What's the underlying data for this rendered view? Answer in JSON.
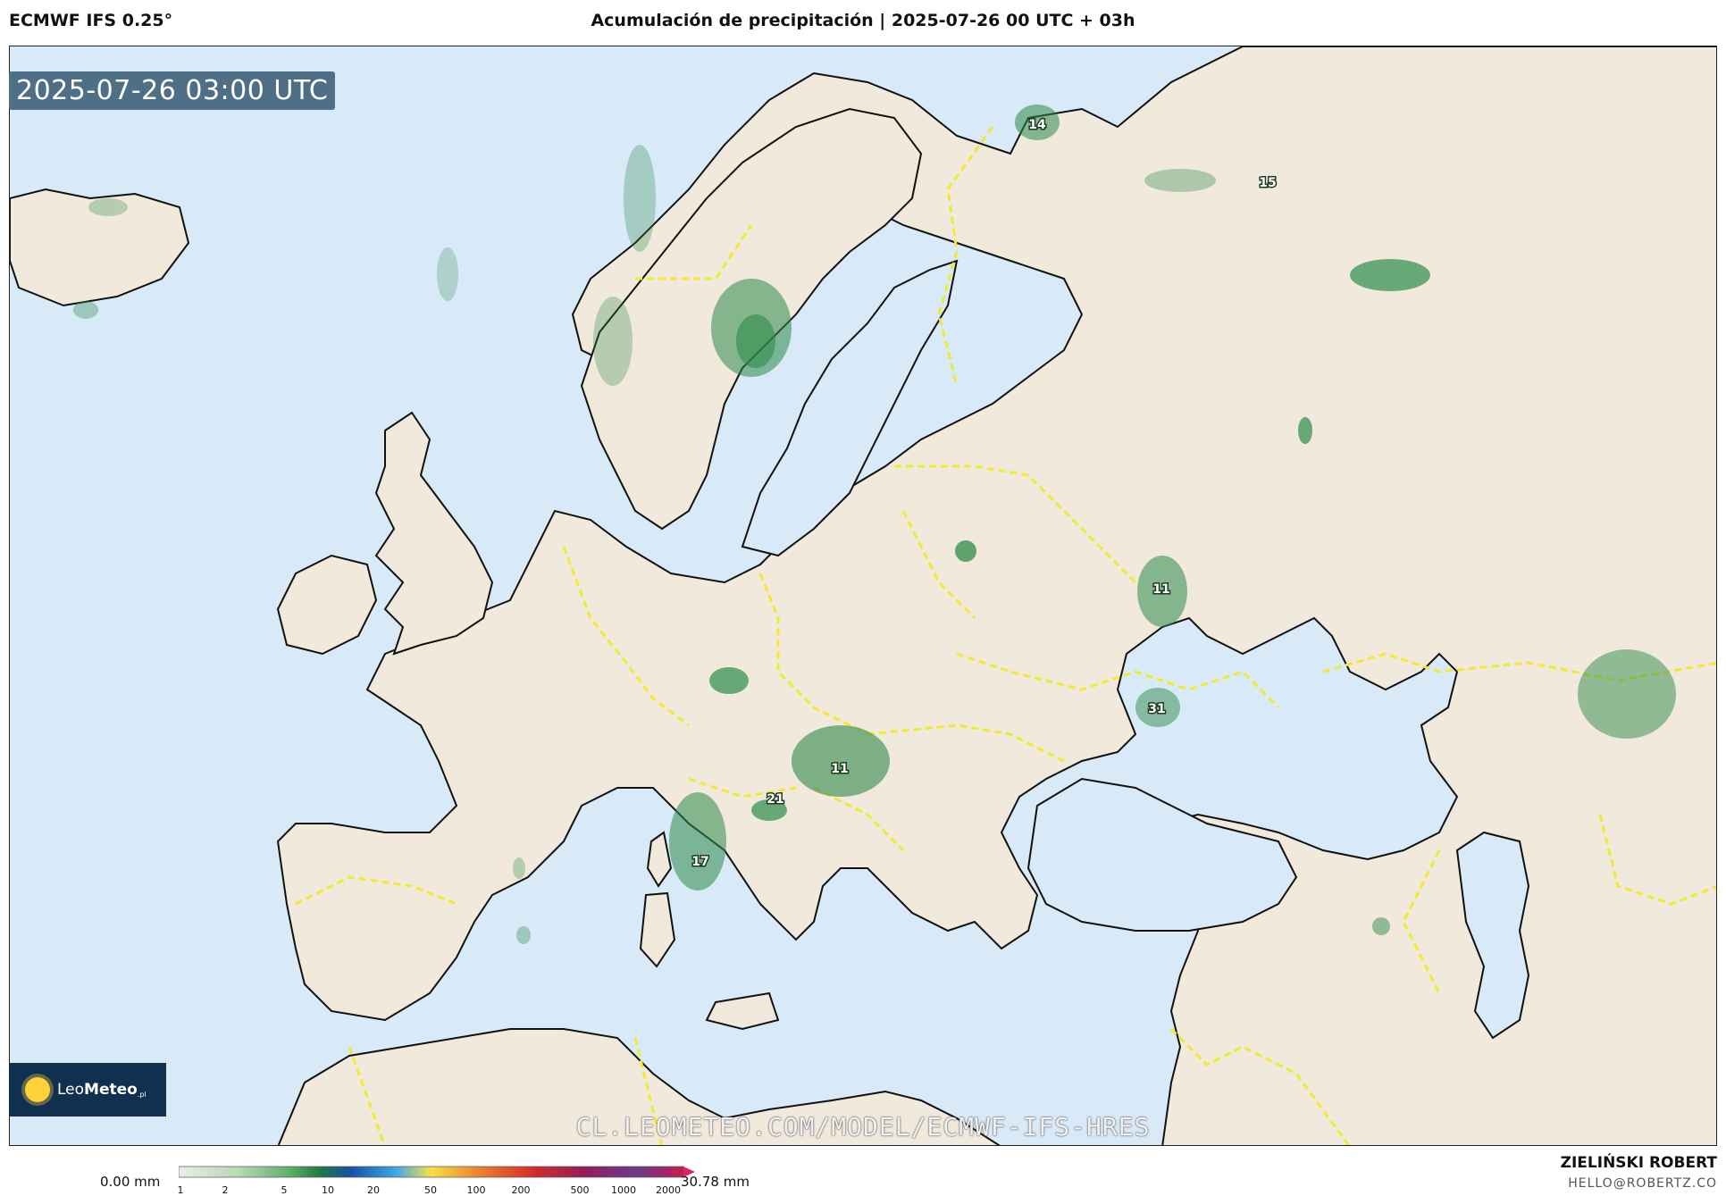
{
  "header": {
    "model": "ECMWF IFS 0.25°",
    "title": "Acumulación de precipitación | 2025-07-26 00 UTC + 03h"
  },
  "map": {
    "valid_time": "2025-07-26 03:00 UTC",
    "watermark": "CL.LEOMETEO.COM/MODEL/ECMWF-IFS-HRES",
    "labels": [
      {
        "id": "lab-14",
        "text": "14"
      },
      {
        "id": "lab-15",
        "text": "15"
      },
      {
        "id": "lab-11a",
        "text": "11"
      },
      {
        "id": "lab-31",
        "text": "31"
      },
      {
        "id": "lab-11b",
        "text": "11"
      },
      {
        "id": "lab-21",
        "text": "21"
      },
      {
        "id": "lab-17",
        "text": "17"
      }
    ],
    "colors": {
      "sea": "#d8e9f7",
      "land": "#f0e9dc",
      "border": "#f2ea30",
      "precip": "#2e8b4a"
    }
  },
  "logo": {
    "name_light": "Leo",
    "name_bold": "Meteo",
    "suffix": ".pl"
  },
  "legend": {
    "min_label": "0.00 mm",
    "max_label": "30.78 mm",
    "ticks": [
      "1",
      "2",
      "5",
      "10",
      "20",
      "50",
      "100",
      "200",
      "500",
      "1000",
      "2000"
    ]
  },
  "author": {
    "name": "ZIELIŃSKI ROBERT",
    "email": "HELLO@ROBERTZ.CO"
  }
}
